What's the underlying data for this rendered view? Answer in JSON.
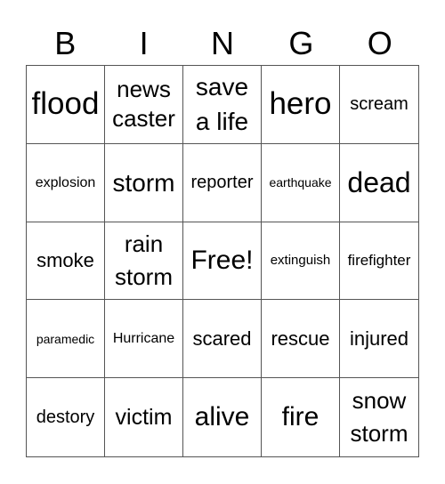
{
  "header": {
    "letters": [
      "B",
      "I",
      "N",
      "G",
      "O"
    ]
  },
  "board": {
    "cells": [
      [
        "flood",
        "news\ncaster",
        "save\na life",
        "hero",
        "scream"
      ],
      [
        "explosion",
        "storm",
        "reporter",
        "earthquake",
        "dead"
      ],
      [
        "smoke",
        "rain\nstorm",
        "Free!",
        "extinguish",
        "firefighter"
      ],
      [
        "paramedic",
        "Hurricane",
        "scared",
        "rescue",
        "injured"
      ],
      [
        "destory",
        "victim",
        "alive",
        "fire",
        "snow\nstorm"
      ]
    ]
  }
}
